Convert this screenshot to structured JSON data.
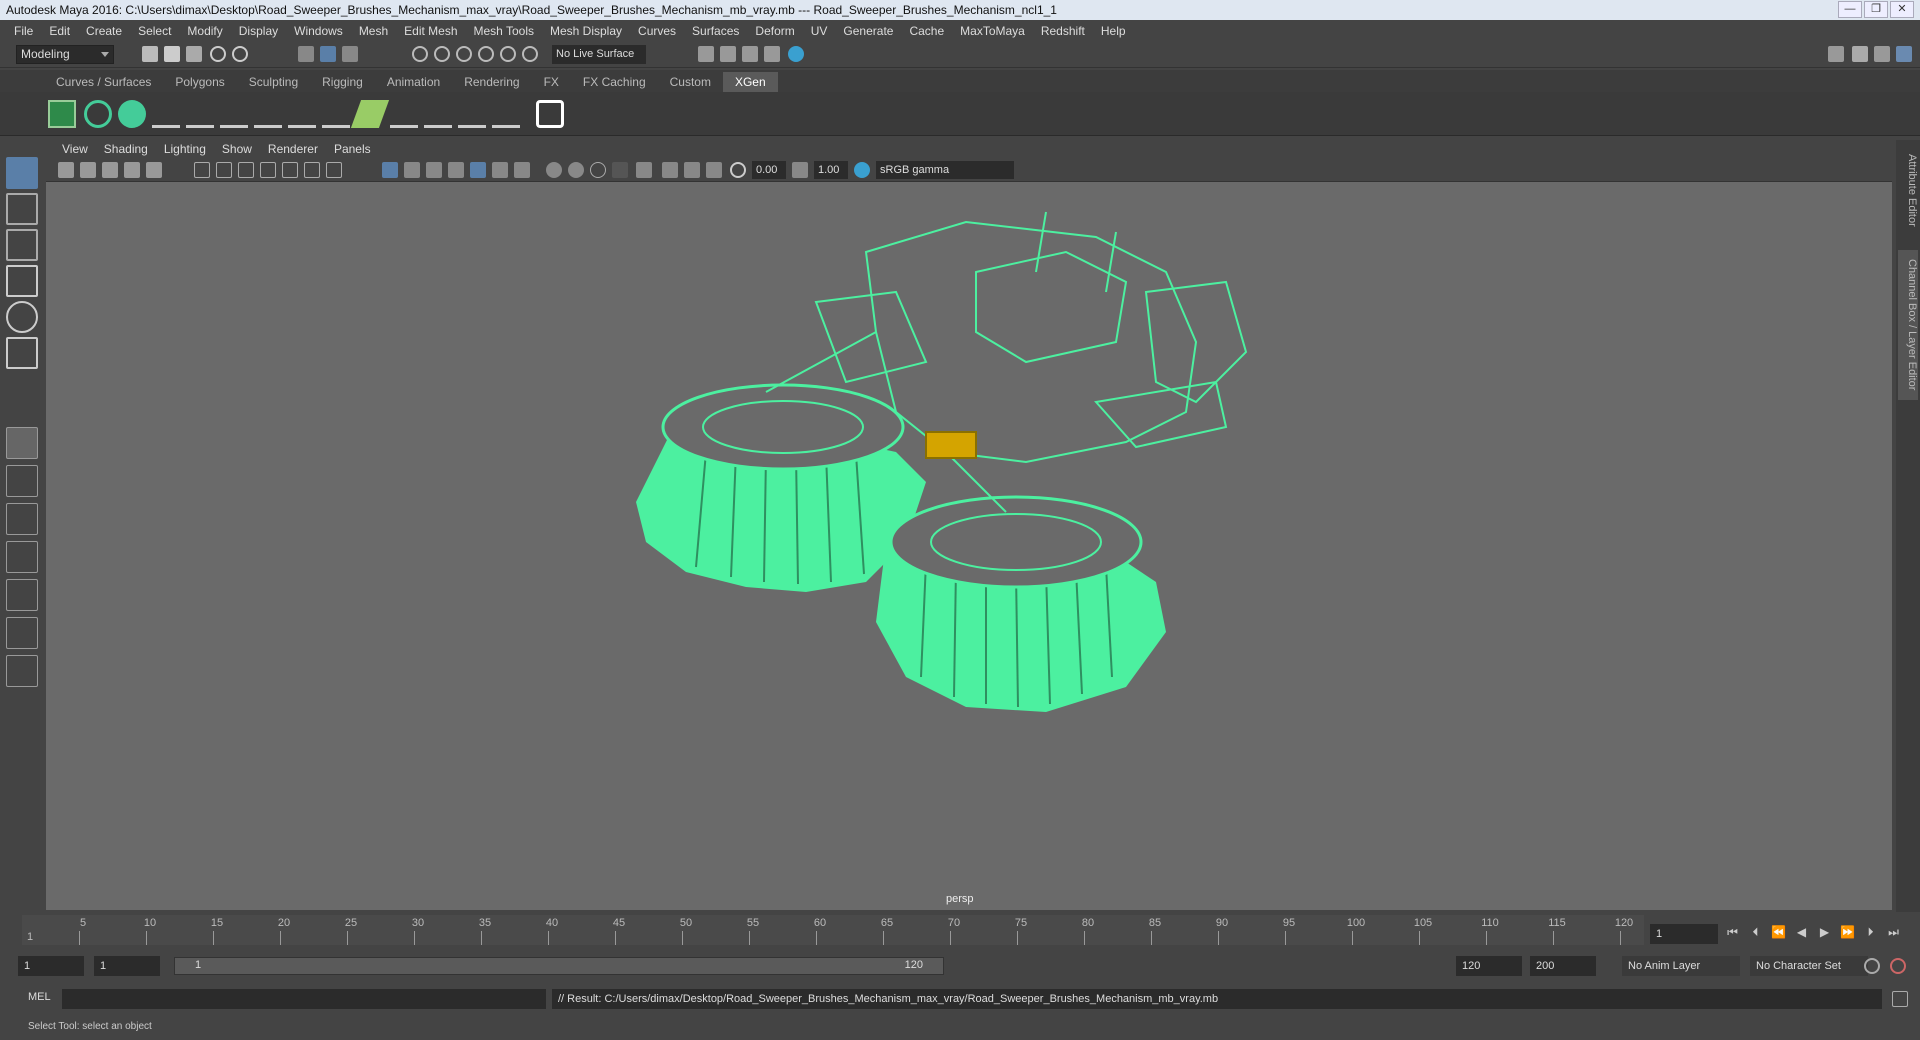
{
  "window": {
    "title": "Autodesk Maya 2016: C:\\Users\\dimax\\Desktop\\Road_Sweeper_Brushes_Mechanism_max_vray\\Road_Sweeper_Brushes_Mechanism_mb_vray.mb   ---   Road_Sweeper_Brushes_Mechanism_ncl1_1",
    "buttons": [
      "—",
      "❐",
      "✕"
    ]
  },
  "menus": [
    "File",
    "Edit",
    "Create",
    "Select",
    "Modify",
    "Display",
    "Windows",
    "Mesh",
    "Edit Mesh",
    "Mesh Tools",
    "Mesh Display",
    "Curves",
    "Surfaces",
    "Deform",
    "UV",
    "Generate",
    "Cache",
    "MaxToMaya",
    "Redshift",
    "Help"
  ],
  "status": {
    "mode": "Modeling",
    "live_surface": "No Live Surface"
  },
  "shelf_tabs": [
    "Curves / Surfaces",
    "Polygons",
    "Sculpting",
    "Rigging",
    "Animation",
    "Rendering",
    "FX",
    "FX Caching",
    "Custom",
    "XGen"
  ],
  "active_shelf": "XGen",
  "panel_menus": [
    "View",
    "Shading",
    "Lighting",
    "Show",
    "Renderer",
    "Panels"
  ],
  "panel_fields": {
    "exposure": "0.00",
    "gamma": "1.00",
    "color_space": "sRGB gamma"
  },
  "viewport": {
    "camera": "persp",
    "wire_color": "#4cf0a0",
    "bg_color": "#6a6a6a"
  },
  "right_tabs": [
    "Attribute Editor",
    "Channel Box / Layer Editor"
  ],
  "timeline": {
    "ticks": [
      "5",
      "10",
      "15",
      "20",
      "25",
      "30",
      "35",
      "40",
      "45",
      "50",
      "55",
      "60",
      "65",
      "70",
      "75",
      "80",
      "85",
      "90",
      "95",
      "100",
      "105",
      "110",
      "115",
      "120"
    ],
    "start_tick": "1",
    "current_frame": "1"
  },
  "range": {
    "start": "1",
    "playback_start": "1",
    "slider_start": "1",
    "slider_end": "120",
    "playback_end": "120",
    "end": "200",
    "anim_layer": "No Anim Layer",
    "character_set": "No Character Set"
  },
  "command": {
    "label": "MEL",
    "result": "// Result: C:/Users/dimax/Desktop/Road_Sweeper_Brushes_Mechanism_max_vray/Road_Sweeper_Brushes_Mechanism_mb_vray.mb"
  },
  "help_line": "Select Tool: select an object"
}
